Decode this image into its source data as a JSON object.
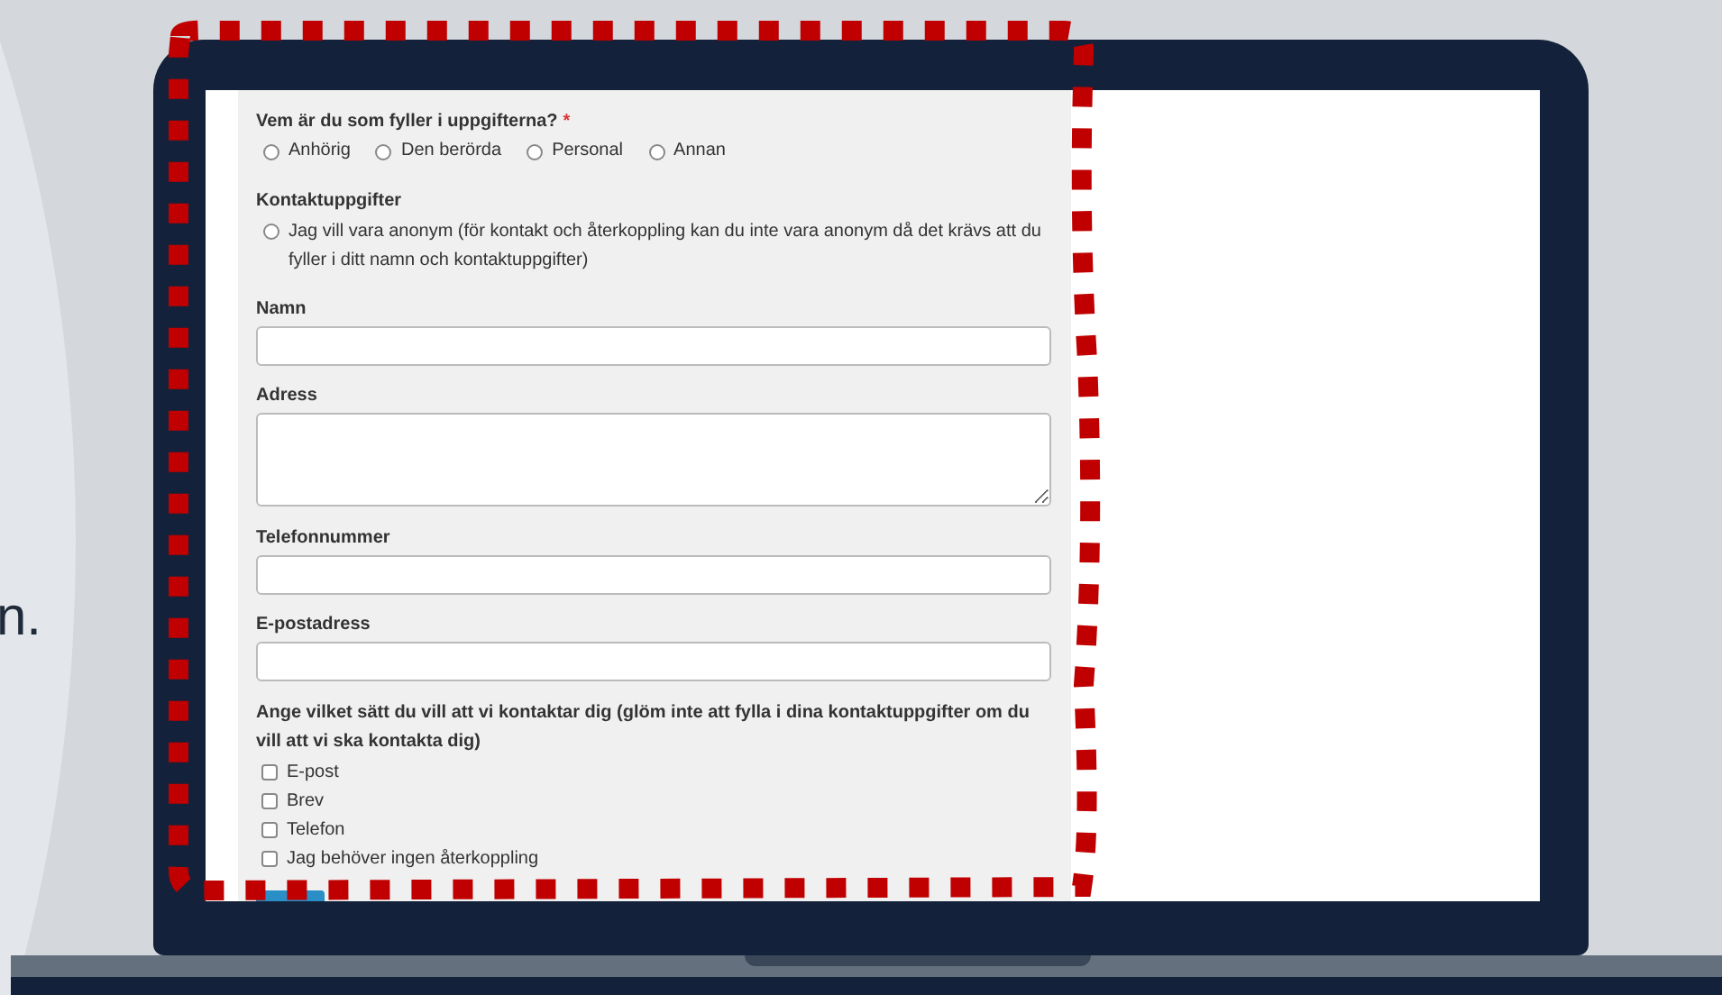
{
  "background_text": "n.",
  "form": {
    "who": {
      "label": "Vem är du som fyller i uppgifterna?",
      "required_mark": "*",
      "options": [
        {
          "label": "Anhörig",
          "selected": false
        },
        {
          "label": "Den berörda",
          "selected": false
        },
        {
          "label": "Personal",
          "selected": false
        },
        {
          "label": "Annan",
          "selected": false
        }
      ]
    },
    "contact": {
      "heading": "Kontaktuppgifter",
      "anonymous": {
        "label": "Jag vill vara anonym (för kontakt och återkoppling kan du inte vara anonym då det krävs att du fyller i ditt namn och kontaktuppgifter)",
        "selected": false
      }
    },
    "fields": [
      {
        "label": "Namn",
        "kind": "text"
      },
      {
        "label": "Adress",
        "kind": "textarea"
      },
      {
        "label": "Telefonnummer",
        "kind": "text"
      },
      {
        "label": "E-postadress",
        "kind": "text"
      }
    ],
    "contact_method": {
      "label": "Ange vilket sätt du vill att vi kontaktar dig (glöm inte att fylla i dina kontaktuppgifter om du vill att vi ska kontakta dig)",
      "options": [
        {
          "label": "E-post",
          "checked": false
        },
        {
          "label": "Brev",
          "checked": false
        },
        {
          "label": "Telefon",
          "checked": false
        },
        {
          "label": "Jag behöver ingen återkoppling",
          "checked": false
        }
      ]
    }
  }
}
